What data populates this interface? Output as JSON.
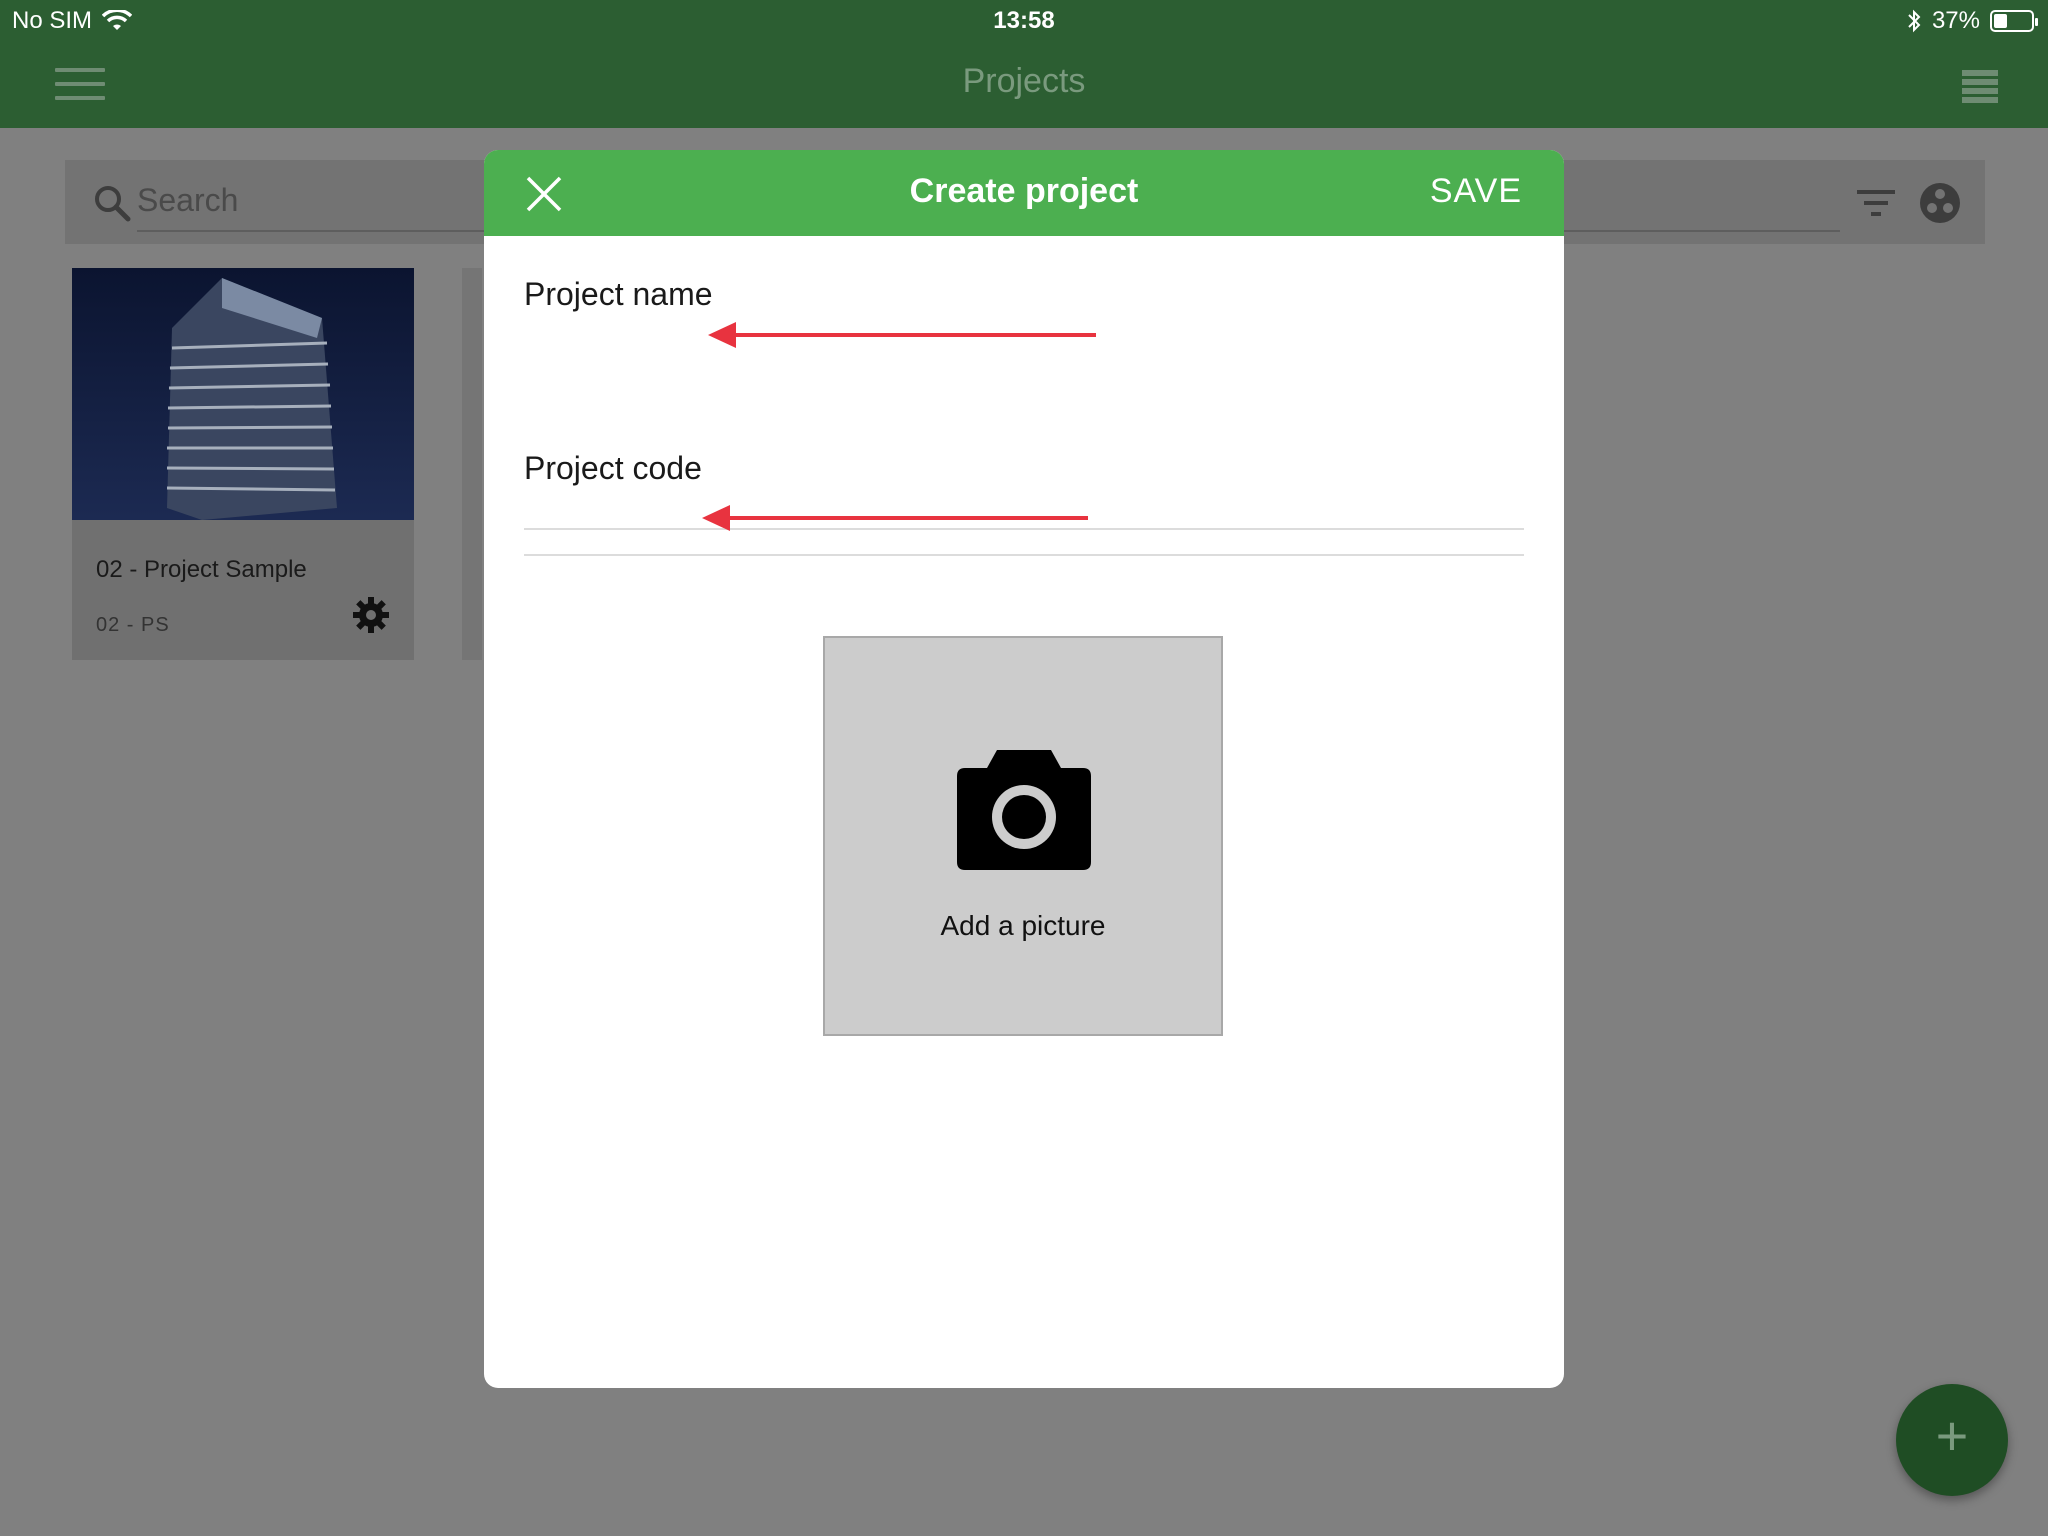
{
  "status_bar": {
    "carrier": "No SIM",
    "time": "13:58",
    "battery_text": "37%",
    "battery_level": 0.37
  },
  "nav": {
    "title": "Projects",
    "menu_icon": "hamburger-icon",
    "view_icon": "list-view-icon"
  },
  "search": {
    "placeholder": "Search"
  },
  "project_card": {
    "title": "02 - Project Sample",
    "code": "02 - PS"
  },
  "modal": {
    "title": "Create project",
    "save_label": "SAVE",
    "fields": [
      {
        "label": "Project name",
        "value": ""
      },
      {
        "label": "Project code",
        "value": ""
      }
    ],
    "picture_label": "Add a picture"
  },
  "fab": {
    "label": "+"
  },
  "colors": {
    "nav_green": "#2c5e32",
    "modal_header_green": "#4caf50",
    "annotation_arrow": "#e8333f"
  }
}
